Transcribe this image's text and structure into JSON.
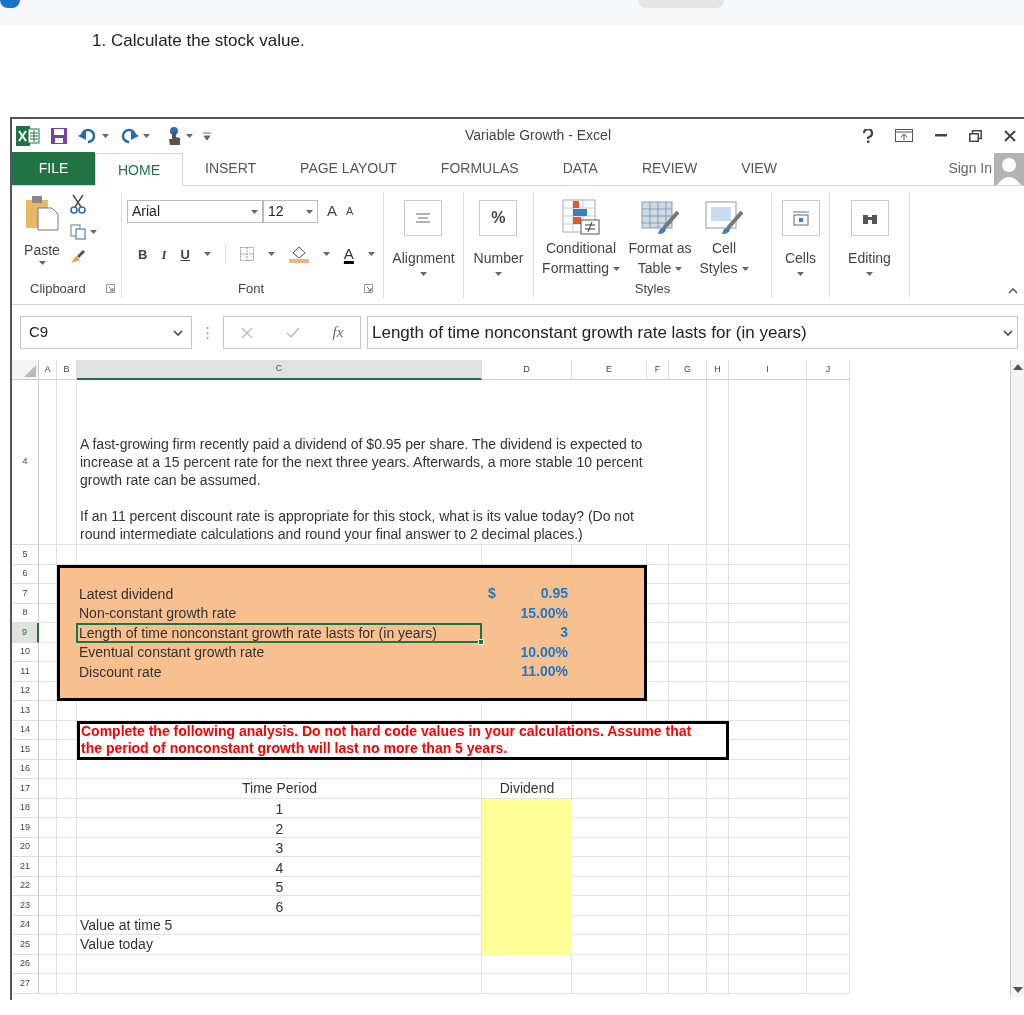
{
  "question": "1. Calculate the stock value.",
  "window": {
    "title": "Variable Growth - Excel"
  },
  "tabs": [
    {
      "label": "FILE",
      "kind": "file"
    },
    {
      "label": "HOME",
      "kind": "tab",
      "selected": true
    },
    {
      "label": "INSERT",
      "kind": "tab",
      "selected": false
    },
    {
      "label": "PAGE LAYOUT",
      "kind": "tab",
      "selected": false
    },
    {
      "label": "FORMULAS",
      "kind": "tab",
      "selected": false
    },
    {
      "label": "DATA",
      "kind": "tab",
      "selected": false
    },
    {
      "label": "REVIEW",
      "kind": "tab",
      "selected": false
    },
    {
      "label": "VIEW",
      "kind": "tab",
      "selected": false
    }
  ],
  "account": {
    "label": "Sign In"
  },
  "ribbon": {
    "clipboard": {
      "paste": "Paste",
      "group": "Clipboard"
    },
    "font": {
      "name": "Arial",
      "size": "12",
      "grow": "A",
      "shrink": "A",
      "styles": [
        "B",
        "I",
        "U"
      ],
      "color_button": "A",
      "group": "Font"
    },
    "alignment": {
      "label": "Alignment"
    },
    "number": {
      "label": "Number",
      "icon": "%"
    },
    "styles": {
      "buttons": [
        "Conditional Formatting",
        "Format as Table",
        "Cell Styles"
      ],
      "group": "Styles"
    },
    "cells": {
      "label": "Cells"
    },
    "editing": {
      "label": "Editing"
    }
  },
  "formula_bar": {
    "name_box": "C9",
    "function_icon": "fx",
    "formula": "Length of time nonconstant growth rate lasts for (in years)"
  },
  "sheet": {
    "columns": [
      {
        "label": "A",
        "selected": false
      },
      {
        "label": "B",
        "selected": false
      },
      {
        "label": "C",
        "selected": true
      },
      {
        "label": "D",
        "selected": false
      },
      {
        "label": "E",
        "selected": false
      },
      {
        "label": "F",
        "selected": false
      },
      {
        "label": "G",
        "selected": false
      },
      {
        "label": "H",
        "selected": false
      },
      {
        "label": "I",
        "selected": false
      },
      {
        "label": "J",
        "selected": false
      }
    ],
    "rows": [
      {
        "label": "4",
        "selected": false
      },
      {
        "label": "5",
        "selected": false
      },
      {
        "label": "6",
        "selected": false
      },
      {
        "label": "7",
        "selected": false
      },
      {
        "label": "8",
        "selected": false
      },
      {
        "label": "9",
        "selected": true
      },
      {
        "label": "10",
        "selected": false
      },
      {
        "label": "11",
        "selected": false
      },
      {
        "label": "12",
        "selected": false
      },
      {
        "label": "13",
        "selected": false
      },
      {
        "label": "14",
        "selected": false
      },
      {
        "label": "15",
        "selected": false
      },
      {
        "label": "16",
        "selected": false
      },
      {
        "label": "17",
        "selected": false
      },
      {
        "label": "18",
        "selected": false
      },
      {
        "label": "19",
        "selected": false
      },
      {
        "label": "20",
        "selected": false
      },
      {
        "label": "21",
        "selected": false
      },
      {
        "label": "22",
        "selected": false
      },
      {
        "label": "23",
        "selected": false
      },
      {
        "label": "24",
        "selected": false
      },
      {
        "label": "25",
        "selected": false
      },
      {
        "label": "26",
        "selected": false
      },
      {
        "label": "27",
        "selected": false
      }
    ],
    "intro": [
      "A fast-growing firm recently paid a dividend of $0.95 per share. The dividend is expected to increase at a 15 percent rate for the next three years. Afterwards, a more stable 10 percent growth rate can be assumed.",
      "If an 11 percent discount rate is appropriate for this stock, what is its value today? (Do not round intermediate calculations and round your final answer to 2 decimal places.)"
    ],
    "inputs": [
      {
        "label": "Latest dividend",
        "symbol": "$",
        "value": "0.95",
        "selected": false
      },
      {
        "label": "Non-constant growth rate",
        "value": "15.00%",
        "selected": false
      },
      {
        "label": "Length of time nonconstant growth rate lasts for (in years)",
        "value": "3",
        "selected": true
      },
      {
        "label": "Eventual constant growth rate",
        "value": "10.00%",
        "selected": false
      },
      {
        "label": "Discount rate",
        "value": "11.00%",
        "selected": false
      }
    ],
    "instruction": "Complete the following analysis. Do not hard code values in your calculations. Assume that the period of nonconstant growth will last no more than 5 years.",
    "headers": [
      "Time Period",
      "Dividend"
    ],
    "analysis": [
      {
        "label": "1",
        "kind": "period"
      },
      {
        "label": "2",
        "kind": "period"
      },
      {
        "label": "3",
        "kind": "period"
      },
      {
        "label": "4",
        "kind": "period"
      },
      {
        "label": "5",
        "kind": "period"
      },
      {
        "label": "6",
        "kind": "period"
      },
      {
        "label": "Value at time 5",
        "kind": "result"
      },
      {
        "label": "Value today",
        "kind": "result"
      }
    ]
  }
}
